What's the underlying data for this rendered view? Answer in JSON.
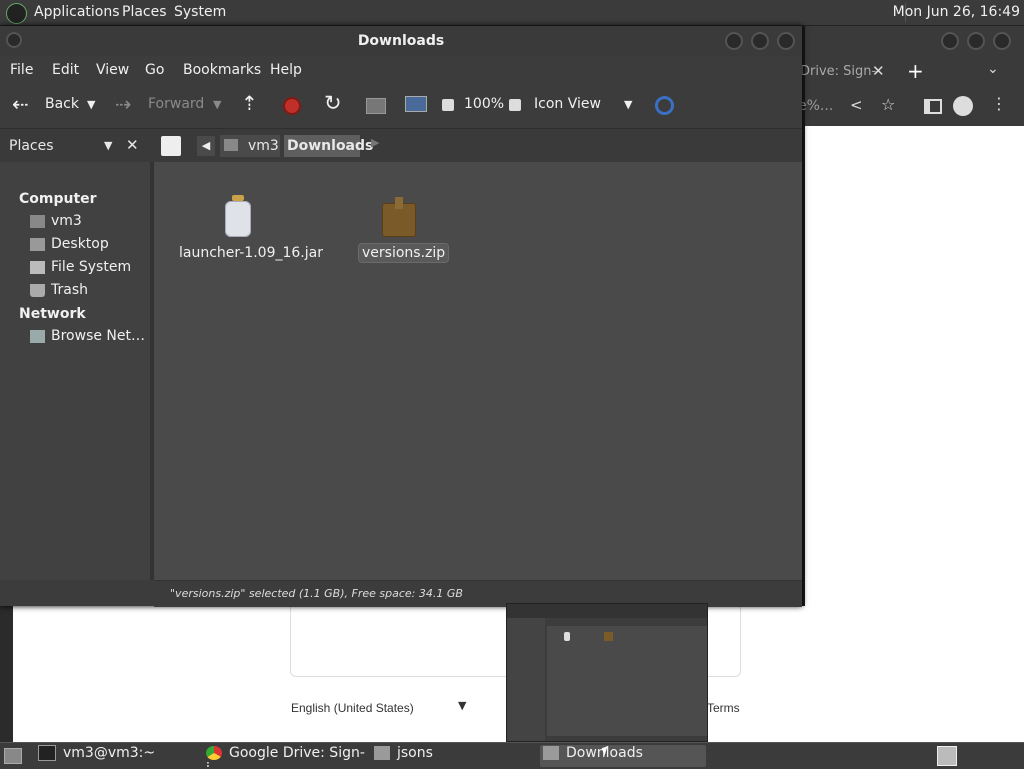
{
  "top_panel": {
    "menus": [
      "Applications",
      "Places",
      "System"
    ],
    "clock": "Mon Jun 26, 16:49"
  },
  "browser": {
    "tab_title": "Drive: Sign-",
    "url_fragment": "e%...",
    "language": "English (United States)",
    "terms": "Terms"
  },
  "file_manager": {
    "title": "Downloads",
    "menubar": [
      "File",
      "Edit",
      "View",
      "Go",
      "Bookmarks",
      "Help"
    ],
    "toolbar": {
      "back": "Back",
      "forward": "Forward",
      "zoom": "100%",
      "view_mode": "Icon View"
    },
    "sidebar": {
      "selector": "Places",
      "sections": [
        {
          "header": "Computer",
          "items": [
            "vm3",
            "Desktop",
            "File System",
            "Trash"
          ]
        },
        {
          "header": "Network",
          "items": [
            "Browse Net…"
          ]
        }
      ]
    },
    "breadcrumbs": [
      "vm3",
      "Downloads"
    ],
    "files": [
      {
        "name": "launcher-1.09_16.jar",
        "icon": "jar-icon",
        "selected": false
      },
      {
        "name": "versions.zip",
        "icon": "archive-icon",
        "selected": true
      }
    ],
    "status": "\"versions.zip\" selected (1.1 GB), Free space: 34.1 GB"
  },
  "taskbar": {
    "tasks": [
      {
        "label": "vm3@vm3:~",
        "icon": "terminal-icon"
      },
      {
        "label": "Google Drive: Sign-i…",
        "icon": "chrome-icon"
      },
      {
        "label": "jsons",
        "icon": "folder-icon"
      },
      {
        "label": "Downloads",
        "icon": "folder-icon",
        "active": true
      }
    ]
  },
  "colors": {
    "panel": "#3b3b3b",
    "window": "#3c3c3c",
    "content": "#4a4a4a",
    "stop_red": "#c0302a",
    "search_blue": "#3b6fc4"
  }
}
